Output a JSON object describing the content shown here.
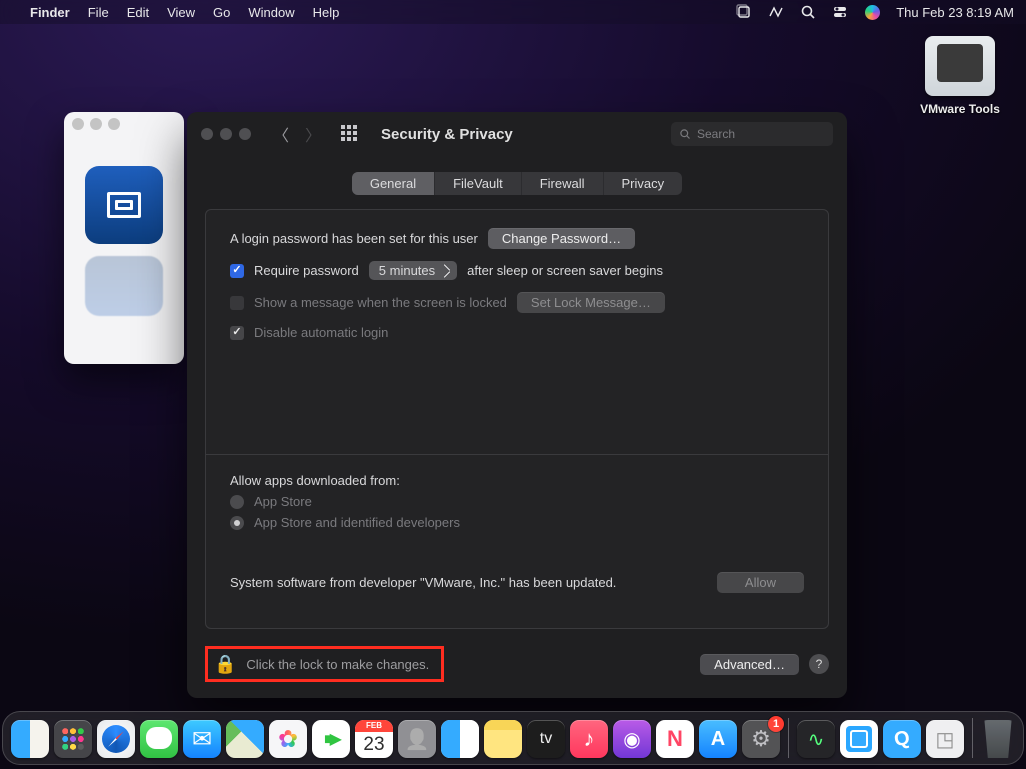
{
  "menubar": {
    "app": "Finder",
    "items": [
      "File",
      "Edit",
      "View",
      "Go",
      "Window",
      "Help"
    ],
    "datetime": "Thu Feb 23  8:19 AM"
  },
  "desktop": {
    "vmware_label": "VMware Tools"
  },
  "prefs": {
    "title": "Security & Privacy",
    "search_placeholder": "Search",
    "tabs": [
      "General",
      "FileVault",
      "Firewall",
      "Privacy"
    ],
    "login_text": "A login password has been set for this user",
    "change_pw": "Change Password…",
    "require_pw_label": "Require password",
    "require_delay": "5 minutes",
    "after_sleep": "after sleep or screen saver begins",
    "show_msg_label": "Show a message when the screen is locked",
    "set_lock_btn": "Set Lock Message…",
    "disable_auto_label": "Disable automatic login",
    "allow_apps": "Allow apps downloaded from:",
    "radio1": "App Store",
    "radio2": "App Store and identified developers",
    "system_sw": "System software from developer \"VMware, Inc.\" has been updated.",
    "allow_btn": "Allow",
    "lock_text": "Click the lock to make changes.",
    "advanced": "Advanced…"
  },
  "dock": {
    "cal_month": "FEB",
    "cal_day": "23",
    "sys_badge": "1"
  }
}
